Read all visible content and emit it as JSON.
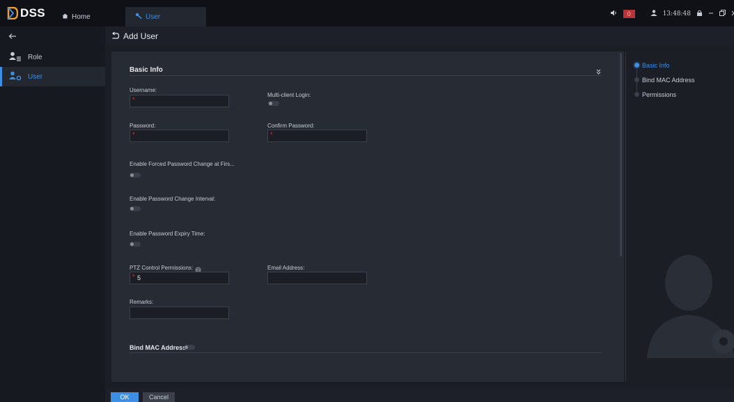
{
  "app": {
    "name": "DSS"
  },
  "tabs": [
    {
      "label": "Home",
      "icon": "home-icon"
    },
    {
      "label": "User",
      "icon": "user-tool-icon"
    }
  ],
  "topbar": {
    "alarm_count": "0",
    "time": "13:48:48"
  },
  "sidebar": {
    "items": [
      {
        "label": "Role",
        "icon": "role-icon"
      },
      {
        "label": "User",
        "icon": "user-icon"
      }
    ]
  },
  "page": {
    "title": "Add User"
  },
  "form": {
    "basic_info_title": "Basic Info",
    "username_label": "Username:",
    "username_value": "",
    "multi_client_label": "Multi-client Login:",
    "password_label": "Password:",
    "confirm_password_label": "Confirm Password:",
    "forced_change_label": "Enable Forced Password Change at Firs...",
    "change_interval_label": "Enable Password Change Interval:",
    "expiry_label": "Enable Password Expiry Time:",
    "ptz_label": "PTZ Control Permissions:",
    "ptz_value": "5",
    "email_label": "Email Address:",
    "remarks_label": "Remarks:",
    "bind_mac_title": "Bind MAC Address",
    "required_mark": "*"
  },
  "right_nav": {
    "items": [
      "Basic Info",
      "Bind MAC Address",
      "Permissions"
    ],
    "active_index": 0
  },
  "buttons": {
    "ok": "OK",
    "cancel": "Cancel"
  },
  "colors": {
    "accent": "#3d8fe6",
    "required": "#e0353b",
    "alarm": "#b8343a"
  }
}
